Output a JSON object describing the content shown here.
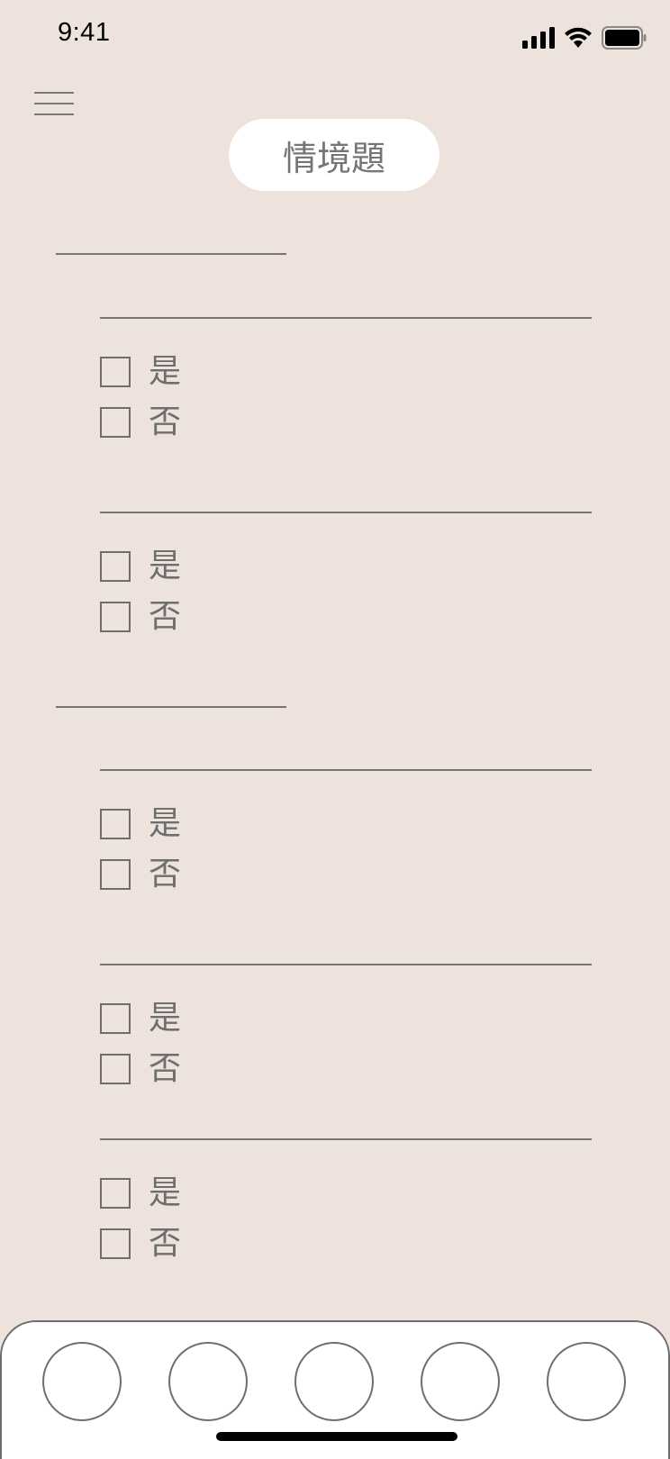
{
  "status_bar": {
    "time": "9:41",
    "icons": [
      "cellular-signal-icon",
      "wifi-icon",
      "battery-icon"
    ]
  },
  "header": {
    "menu_icon": "hamburger-menu-icon",
    "title": "情境題"
  },
  "options": {
    "yes": "是",
    "no": "否"
  },
  "questions": [
    {
      "yes": "是",
      "no": "否"
    },
    {
      "yes": "是",
      "no": "否"
    },
    {
      "yes": "是",
      "no": "否"
    },
    {
      "yes": "是",
      "no": "否"
    },
    {
      "yes": "是",
      "no": "否"
    }
  ],
  "tab_bar": {
    "tabs": [
      "tab-1",
      "tab-2",
      "tab-3",
      "tab-4",
      "tab-5"
    ]
  },
  "colors": {
    "background": "#ede3dc",
    "pill": "#ffffff",
    "line": "#757575",
    "text": "#6e6e6e"
  }
}
